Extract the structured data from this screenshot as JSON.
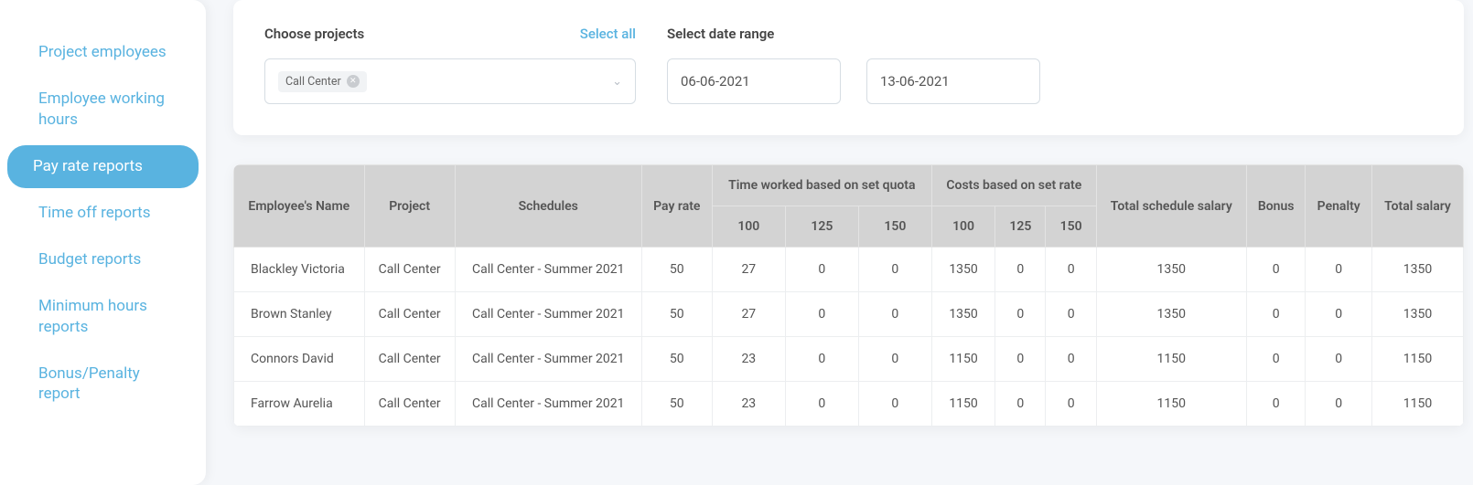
{
  "sidebar": {
    "items": [
      {
        "label": "Project employees",
        "active": false
      },
      {
        "label": "Employee working hours",
        "active": false
      },
      {
        "label": "Pay rate reports",
        "active": true
      },
      {
        "label": "Time off reports",
        "active": false
      },
      {
        "label": "Budget reports",
        "active": false
      },
      {
        "label": "Minimum hours reports",
        "active": false
      },
      {
        "label": "Bonus/Penalty report",
        "active": false
      }
    ]
  },
  "filters": {
    "choose_projects_label": "Choose projects",
    "select_all_label": "Select all",
    "project_chip": "Call Center",
    "date_range_label": "Select date range",
    "date_from": "06-06-2021",
    "date_to": "13-06-2021"
  },
  "table": {
    "headers": {
      "employee": "Employee's Name",
      "project": "Project",
      "schedules": "Schedules",
      "pay_rate": "Pay rate",
      "time_group": "Time worked based on set quota",
      "cost_group": "Costs based on set rate",
      "q100": "100",
      "q125": "125",
      "q150": "150",
      "c100": "100",
      "c125": "125",
      "c150": "150",
      "total_schedule_salary": "Total schedule salary",
      "bonus": "Bonus",
      "penalty": "Penalty",
      "total_salary": "Total salary"
    },
    "rows": [
      {
        "name": "Blackley Victoria",
        "project": "Call Center",
        "schedule": "Call Center - Summer 2021",
        "pay_rate": "50",
        "t100": "27",
        "t125": "0",
        "t150": "0",
        "c100": "1350",
        "c125": "0",
        "c150": "0",
        "tss": "1350",
        "bonus": "0",
        "penalty": "0",
        "total": "1350"
      },
      {
        "name": "Brown Stanley",
        "project": "Call Center",
        "schedule": "Call Center - Summer 2021",
        "pay_rate": "50",
        "t100": "27",
        "t125": "0",
        "t150": "0",
        "c100": "1350",
        "c125": "0",
        "c150": "0",
        "tss": "1350",
        "bonus": "0",
        "penalty": "0",
        "total": "1350"
      },
      {
        "name": "Connors David",
        "project": "Call Center",
        "schedule": "Call Center - Summer 2021",
        "pay_rate": "50",
        "t100": "23",
        "t125": "0",
        "t150": "0",
        "c100": "1150",
        "c125": "0",
        "c150": "0",
        "tss": "1150",
        "bonus": "0",
        "penalty": "0",
        "total": "1150"
      },
      {
        "name": "Farrow Aurelia",
        "project": "Call Center",
        "schedule": "Call Center - Summer 2021",
        "pay_rate": "50",
        "t100": "23",
        "t125": "0",
        "t150": "0",
        "c100": "1150",
        "c125": "0",
        "c150": "0",
        "tss": "1150",
        "bonus": "0",
        "penalty": "0",
        "total": "1150"
      }
    ]
  }
}
